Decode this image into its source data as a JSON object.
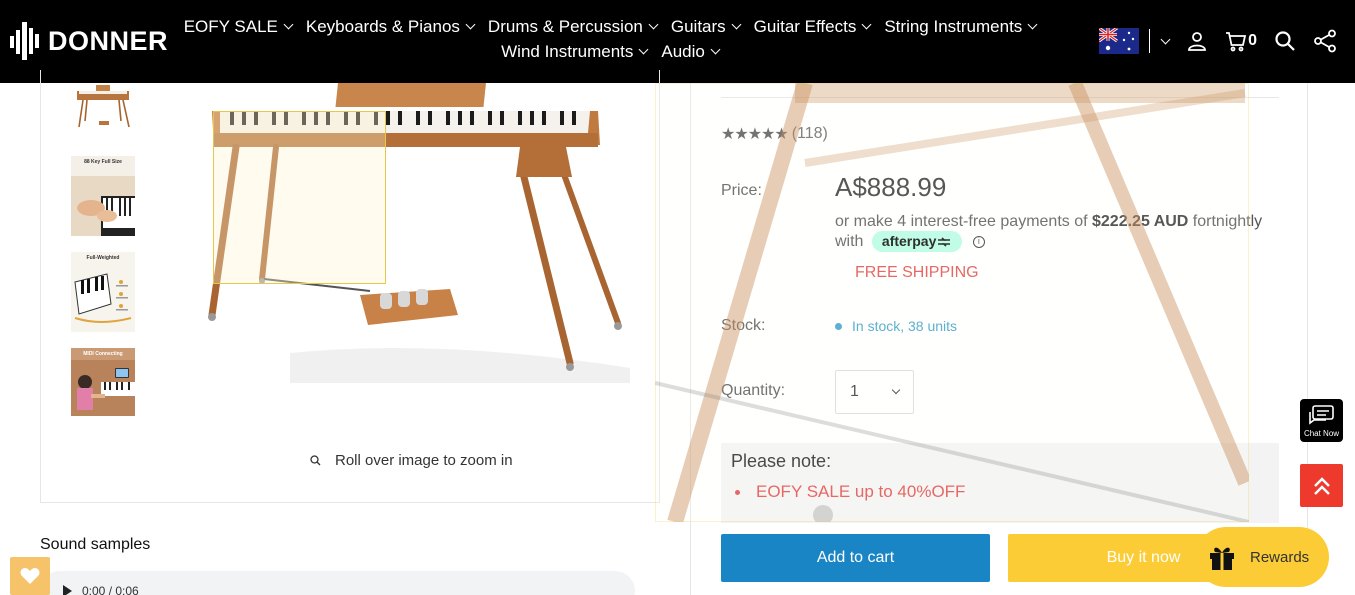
{
  "header": {
    "brand": "DONNER",
    "nav_row1": [
      "EOFY SALE",
      "Keyboards & Pianos",
      "Drums & Percussion",
      "Guitars",
      "Guitar Effects",
      "String Instruments"
    ],
    "nav_row2": [
      "Wind Instruments",
      "Audio"
    ],
    "cart_count": "0",
    "colors": {
      "background": "#000000",
      "text": "#ffffff"
    }
  },
  "gallery": {
    "thumbnails": [
      {
        "caption": ""
      },
      {
        "caption": "88 Key Full Size"
      },
      {
        "caption": "Full-Weighted"
      },
      {
        "caption": "MIDI Connecting"
      }
    ],
    "zoom_hint": "Roll over image to zoom in"
  },
  "product": {
    "rating_count": "(118)",
    "price_label": "Price:",
    "price": "A$888.99",
    "installments_pre": "or make 4 interest-free payments of ",
    "installments_amount": "$222.25 AUD",
    "installments_post": " fortnightly",
    "installments_with": "with",
    "afterpay_label": "afterpay",
    "free_shipping": "FREE SHIPPING",
    "stock_label": "Stock:",
    "stock_value": "In stock, 38 units",
    "quantity_label": "Quantity:",
    "quantity_value": "1",
    "note_title": "Please note:",
    "note_items": [
      "EOFY SALE up to 40%OFF"
    ],
    "add_to_cart": "Add to cart",
    "buy_now": "Buy it now",
    "colors": {
      "price_accent": "#e14747",
      "stock": "#3a9fc7",
      "add_to_cart": "#1a85c4",
      "buy_now": "#fccc36"
    }
  },
  "sound": {
    "title": "Sound samples",
    "player_time": "0:00 / 0:06"
  },
  "widgets": {
    "chat_label": "Chat Now",
    "rewards_label": "Rewards"
  }
}
